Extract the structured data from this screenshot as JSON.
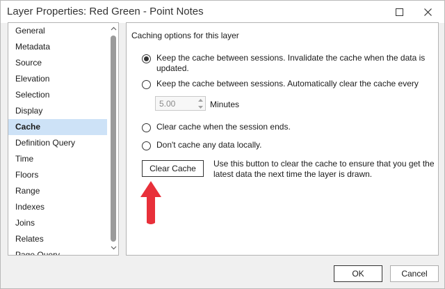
{
  "window": {
    "title": "Layer Properties: Red Green - Point Notes",
    "maximize_icon": "maximize-icon",
    "close_icon": "close-icon"
  },
  "sidebar": {
    "items": [
      {
        "label": "General",
        "selected": false
      },
      {
        "label": "Metadata",
        "selected": false
      },
      {
        "label": "Source",
        "selected": false
      },
      {
        "label": "Elevation",
        "selected": false
      },
      {
        "label": "Selection",
        "selected": false
      },
      {
        "label": "Display",
        "selected": false
      },
      {
        "label": "Cache",
        "selected": true
      },
      {
        "label": "Definition Query",
        "selected": false
      },
      {
        "label": "Time",
        "selected": false
      },
      {
        "label": "Floors",
        "selected": false
      },
      {
        "label": "Range",
        "selected": false
      },
      {
        "label": "Indexes",
        "selected": false
      },
      {
        "label": "Joins",
        "selected": false
      },
      {
        "label": "Relates",
        "selected": false
      },
      {
        "label": "Page Query",
        "selected": false
      }
    ],
    "selected_color": "#cde2f7"
  },
  "cache": {
    "section_title": "Caching options for this layer",
    "options": [
      {
        "label": "Keep the cache between sessions. Invalidate the cache when the data is updated.",
        "checked": true
      },
      {
        "label": "Keep the cache between sessions. Automatically clear the cache every",
        "checked": false
      },
      {
        "label": "Clear cache when the session ends.",
        "checked": false
      },
      {
        "label": "Don't cache any data locally.",
        "checked": false
      }
    ],
    "interval_value": "5.00",
    "interval_unit": "Minutes",
    "clear_button_label": "Clear Cache",
    "clear_description": "Use this button to clear the cache to ensure that you get the latest data the next time the layer is drawn.",
    "annotation_arrow_color": "#e8303a"
  },
  "footer": {
    "ok_label": "OK",
    "cancel_label": "Cancel"
  }
}
